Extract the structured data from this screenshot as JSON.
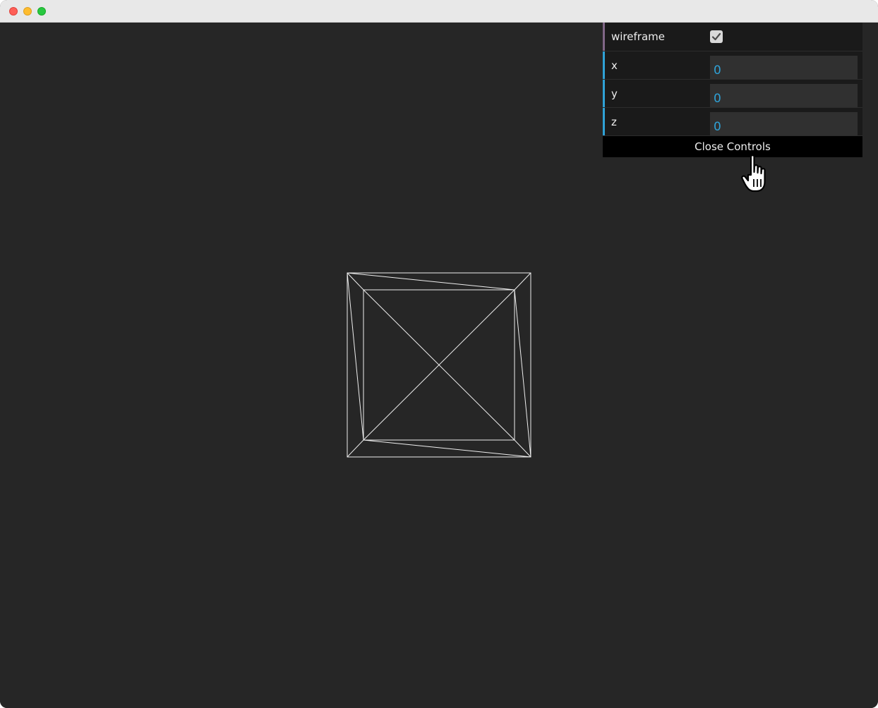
{
  "window": {
    "traffic_lights": [
      "close",
      "minimize",
      "maximize"
    ]
  },
  "scene": {
    "mode": "wireframe",
    "line_color": "#ffffff",
    "background": "#262626"
  },
  "controls": {
    "wireframe": {
      "label": "wireframe",
      "checked": true
    },
    "x": {
      "label": "x",
      "value": "0"
    },
    "y": {
      "label": "y",
      "value": "0"
    },
    "z": {
      "label": "z",
      "value": "0"
    },
    "close_label": "Close Controls"
  },
  "colors": {
    "bool_accent": "#806787",
    "number_accent": "#2fa1d6",
    "panel_bg": "#1a1a1a",
    "input_bg": "#303030"
  },
  "cursor": {
    "icon": "pointing-hand-icon"
  }
}
